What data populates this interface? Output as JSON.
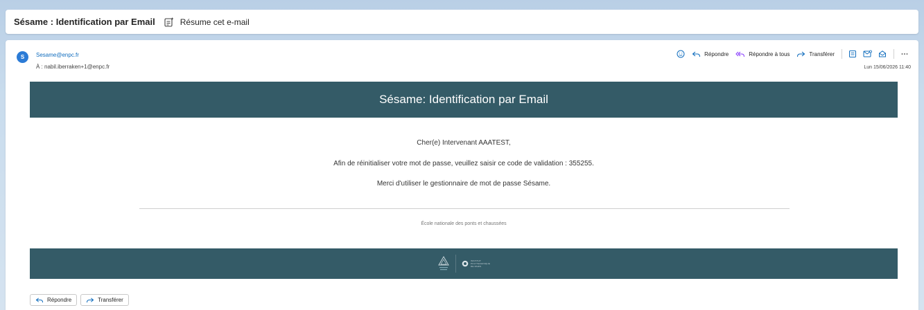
{
  "subject": {
    "title": "Sésame : Identification par Email",
    "summary_label": "Résume cet e-mail"
  },
  "message": {
    "avatar_initial": "S",
    "sender": "Sesame@enpc.fr",
    "recipient": "À : nabil.iberraken+1@enpc.fr",
    "date": "Lun 15/06/2026 11:40",
    "actions": {
      "reply": "Répondre",
      "reply_all": "Répondre à tous",
      "forward": "Transférer"
    }
  },
  "email_body": {
    "header": "Sésame: Identification par Email",
    "greeting": "Cher(e) Intervenant AAATEST,",
    "instruction": "Afin de réinitialiser votre mot de passe, veuillez saisir ce code de validation : 355255.",
    "thanks": "Merci d'utiliser le gestionnaire de mot de passe Sésame.",
    "school": "École nationale des ponts et chaussées",
    "logo_ip_text": [
      "INSTITUT",
      "POLYTECHNIQUE",
      "DE PARIS"
    ]
  },
  "bottom_actions": {
    "reply": "Répondre",
    "forward": "Transférer"
  },
  "colors": {
    "banner": "#345b67",
    "accent": "#0f6cbd",
    "reply_all_icon": "#8a3ffc"
  },
  "icons": [
    "summary-icon",
    "emoji-icon",
    "reply-icon",
    "reply-all-icon",
    "forward-icon",
    "immersive-reader-icon",
    "mark-unread-icon",
    "envelope-icon",
    "more-icon",
    "enpc-logo-icon",
    "ip-paris-logo-icon"
  ]
}
